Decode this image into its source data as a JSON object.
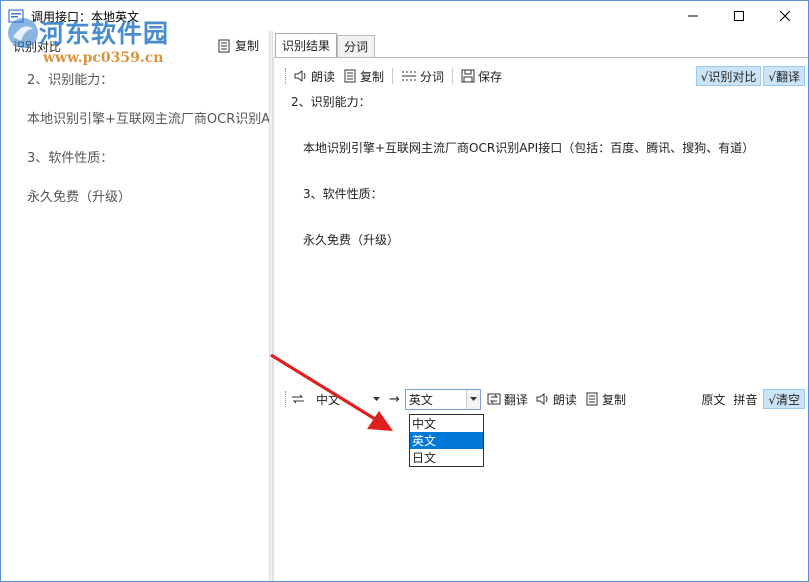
{
  "window": {
    "title": "调用接口：本地英文",
    "minimize_icon": "minimize-icon",
    "maximize_icon": "maximize-icon",
    "close_icon": "close-icon"
  },
  "watermark": {
    "name": "河东软件园",
    "url": "www.pc0359.cn"
  },
  "left_pane": {
    "compare_label": "识别对比",
    "copy_label": "复制",
    "lines": [
      "2、识别能力：",
      "本地识别引擎+互联网主流厂商OCR识别API接口（包括：百度、腾讯、搜狗、有道）",
      "3、软件性质：",
      "永久免费（升级）"
    ]
  },
  "tabs": [
    {
      "label": "识别结果",
      "active": true
    },
    {
      "label": "分词",
      "active": false
    }
  ],
  "result_toolbar": {
    "read_label": "朗读",
    "copy_label": "复制",
    "segment_label": "分词",
    "save_label": "保存",
    "compare_toggle": "√识别对比",
    "translate_toggle": "√翻译"
  },
  "result_text": {
    "lines": [
      "2、识别能力：",
      "本地识别引擎+互联网主流厂商OCR识别API接口（包括：百度、腾讯、搜狗、有道）",
      "3、软件性质：",
      "永久免费（升级）"
    ]
  },
  "translate_toolbar": {
    "source_lang": "中文",
    "arrow": "→",
    "target_lang": "英文",
    "translate_label": "翻译",
    "read_label": "朗读",
    "copy_label": "复制",
    "original_label": "原文",
    "pinyin_label": "拼音",
    "clear_toggle": "√清空"
  },
  "dropdown": {
    "options": [
      "中文",
      "英文",
      "日文"
    ],
    "selected": "英文"
  },
  "colors": {
    "accent": "#0078d7",
    "toggle_bg": "#cce4f7",
    "annotation_arrow": "#e02020",
    "watermark_blue": "#2b78c8",
    "watermark_orange": "#d7892a"
  }
}
